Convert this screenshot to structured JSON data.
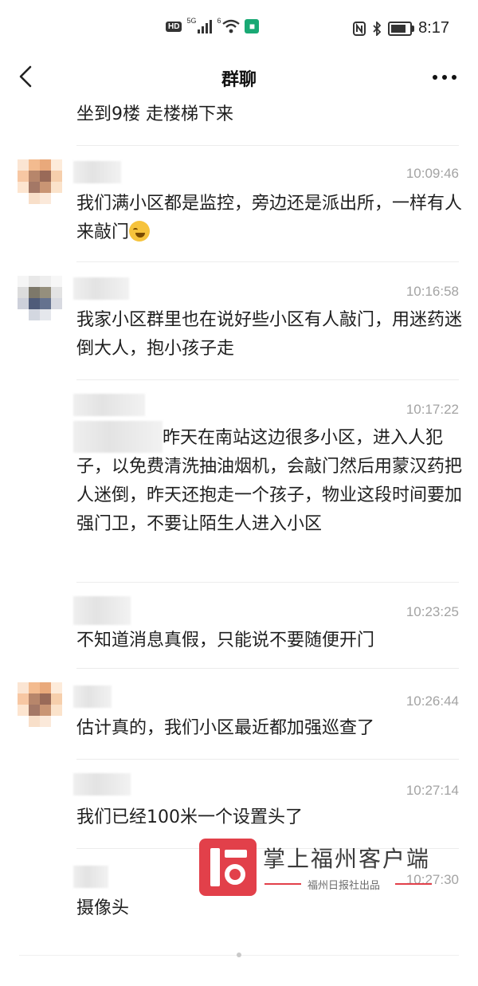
{
  "status_bar": {
    "left_badges": [
      "HD",
      "5G",
      "6"
    ],
    "time": "8:17",
    "battery_level": 0.8
  },
  "nav": {
    "title": "群聊"
  },
  "messages": [
    {
      "time": "",
      "text": "坐到9楼 走楼梯下来"
    },
    {
      "time": "10:09:46",
      "text": "我们满小区都是监控，旁边还是派出所，一样有人来敲门",
      "emoji": "face-with-tears-of-joy"
    },
    {
      "time": "10:16:58",
      "text": "我家小区群里也在说好些小区有人敲门，用迷药迷倒大人，抱小孩子走"
    },
    {
      "time": "10:17:22",
      "text": "昨天在南站这边很多小区，进入人犯子，以免费清洗抽油烟机，会敲门然后用蒙汉药把人迷倒，昨天还抱走一个孩子，物业这段时间要加强门卫，不要让陌生人进入小区"
    },
    {
      "time": "10:23:25",
      "text": "不知道消息真假，只能说不要随便开门"
    },
    {
      "time": "10:26:44",
      "text": "估计真的，我们小区最近都加强巡查了"
    },
    {
      "time": "10:27:14",
      "text": "我们已经100米一个设置头了"
    },
    {
      "time": "10:27:30",
      "text": "摄像头"
    }
  ],
  "watermark": {
    "title": "掌上福州客户端",
    "subtitle": "福州日报社出品"
  },
  "colors": {
    "time_gray": "#a3a3a3",
    "watermark_red": "#e2404a"
  }
}
